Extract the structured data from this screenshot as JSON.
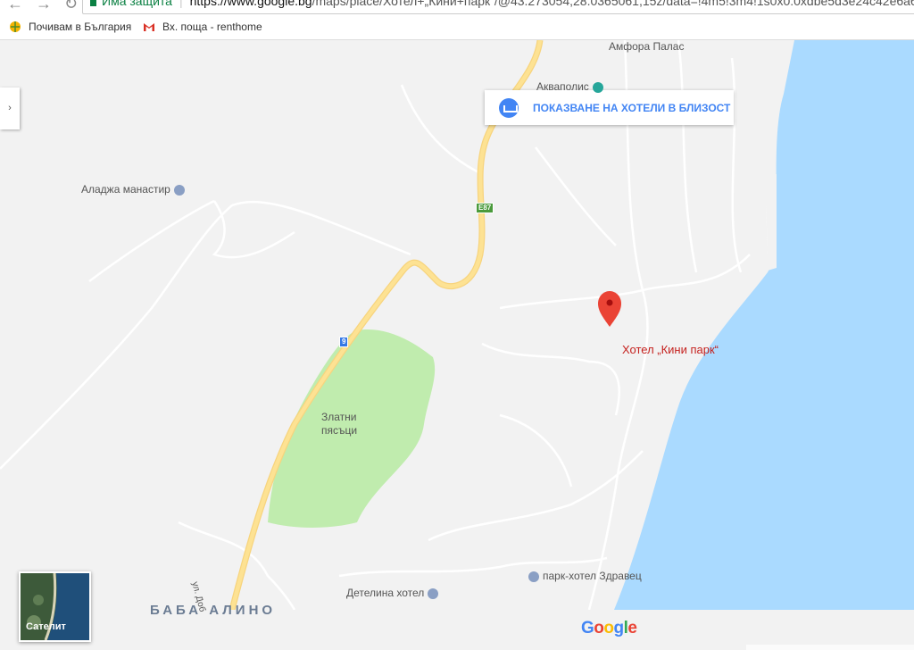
{
  "browser": {
    "secure_label": "Има защита",
    "url_domain": "https://www.google.bg",
    "url_path": "/maps/place/Хотел+„Кини+парк“/@43.273054,28.0365061,15z/data=!4m5!3m4!1s0x0:0xdbe5d3e24c42e6a6"
  },
  "bookmarks": [
    {
      "label": "Почивам в България",
      "icon": "globe-icon"
    },
    {
      "label": "Вх. поща - renthome",
      "icon": "gmail-icon"
    }
  ],
  "map": {
    "hotels_button": "ПОКАЗВАНЕ НА ХОТЕЛИ В БЛИЗОСТ",
    "labels": {
      "aladzha": "Аладжа манастир",
      "akvapolis": "Акваполис",
      "anfora": "Амфора Палас",
      "zlatni": "Златни",
      "pyasatsi": "пясъци",
      "baba_alino": "БАБА АЛИНО",
      "detelina": "Детелина хотел",
      "zdravets": "парк-хотел Здравец",
      "street": "ул. Доб"
    },
    "marker": "Хотел „Кини парк“",
    "road_shields": {
      "e87": "E87",
      "r9": "9"
    },
    "satellite": "Сателит",
    "google": "Google",
    "colors": {
      "sea": "#aadaff",
      "park": "#c0ecae",
      "highway": "#fde293",
      "marker": "#ea4335"
    }
  }
}
